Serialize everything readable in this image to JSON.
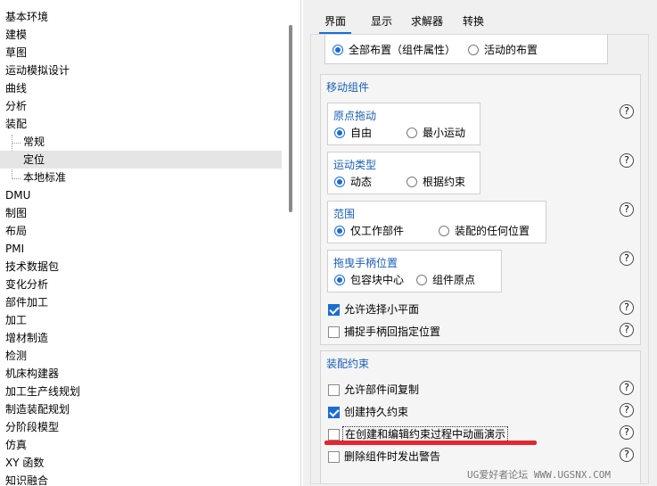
{
  "tree": {
    "items": [
      {
        "label": "基本环境"
      },
      {
        "label": "建模"
      },
      {
        "label": "草图"
      },
      {
        "label": "运动模拟设计"
      },
      {
        "label": "曲线"
      },
      {
        "label": "分析"
      },
      {
        "label": "装配"
      },
      {
        "label": "常规"
      },
      {
        "label": "定位"
      },
      {
        "label": "本地标准"
      },
      {
        "label": "DMU"
      },
      {
        "label": "制图"
      },
      {
        "label": "布局"
      },
      {
        "label": "PMI"
      },
      {
        "label": "技术数据包"
      },
      {
        "label": "变化分析"
      },
      {
        "label": "部件加工"
      },
      {
        "label": "加工"
      },
      {
        "label": "增材制造"
      },
      {
        "label": "检测"
      },
      {
        "label": "机床构建器"
      },
      {
        "label": "加工生产线规划"
      },
      {
        "label": "制造装配规划"
      },
      {
        "label": "分阶段模型"
      },
      {
        "label": "仿真"
      },
      {
        "label": "XY 函数"
      },
      {
        "label": "知识融合"
      }
    ]
  },
  "tabs": [
    {
      "label": "界面"
    },
    {
      "label": "显示"
    },
    {
      "label": "求解器"
    },
    {
      "label": "转换"
    }
  ],
  "top_group": {
    "option_all": "全部布置（组件属性）",
    "option_active": "活动的布置"
  },
  "move_components": {
    "title": "移动组件",
    "origin_drag": {
      "title": "原点拖动",
      "opt1": "自由",
      "opt2": "最小运动"
    },
    "motion_type": {
      "title": "运动类型",
      "opt1": "动态",
      "opt2": "根据约束"
    },
    "scope": {
      "title": "范围",
      "opt1": "仅工作部件",
      "opt2": "装配的任何位置"
    },
    "handle_pos": {
      "title": "拖曳手柄位置",
      "opt1": "包容块中心",
      "opt2": "组件原点"
    },
    "allow_small_plane": "允许选择小平面",
    "snap_handle": "捕捉手柄回指定位置"
  },
  "assembly_constraints": {
    "title": "装配约束",
    "allow_copy": "允许部件间复制",
    "create_persistent": "创建持久约束",
    "animate": "在创建和编辑约束过程中动画演示",
    "warn_delete": "删除组件时发出警告"
  },
  "help_glyph": "?",
  "watermark": "UG爱好者论坛 WWW.UGSNX.COM",
  "colors": {
    "accent": "#1a6dd1",
    "section_title": "#1a5fb4",
    "highlight": "#e3262d"
  }
}
